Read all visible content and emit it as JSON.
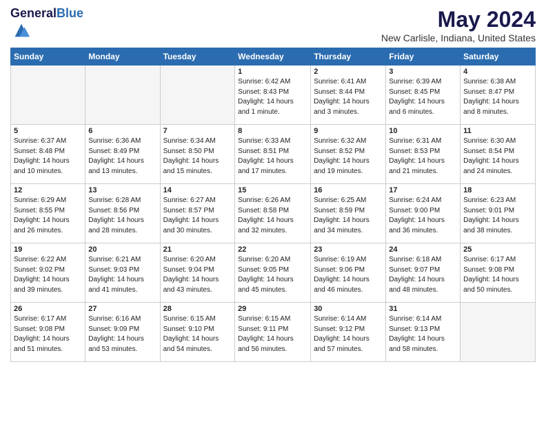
{
  "header": {
    "logo_general": "General",
    "logo_blue": "Blue",
    "month_year": "May 2024",
    "location": "New Carlisle, Indiana, United States"
  },
  "weekdays": [
    "Sunday",
    "Monday",
    "Tuesday",
    "Wednesday",
    "Thursday",
    "Friday",
    "Saturday"
  ],
  "weeks": [
    [
      {
        "day": "",
        "info": ""
      },
      {
        "day": "",
        "info": ""
      },
      {
        "day": "",
        "info": ""
      },
      {
        "day": "1",
        "info": "Sunrise: 6:42 AM\nSunset: 8:43 PM\nDaylight: 14 hours\nand 1 minute."
      },
      {
        "day": "2",
        "info": "Sunrise: 6:41 AM\nSunset: 8:44 PM\nDaylight: 14 hours\nand 3 minutes."
      },
      {
        "day": "3",
        "info": "Sunrise: 6:39 AM\nSunset: 8:45 PM\nDaylight: 14 hours\nand 6 minutes."
      },
      {
        "day": "4",
        "info": "Sunrise: 6:38 AM\nSunset: 8:47 PM\nDaylight: 14 hours\nand 8 minutes."
      }
    ],
    [
      {
        "day": "5",
        "info": "Sunrise: 6:37 AM\nSunset: 8:48 PM\nDaylight: 14 hours\nand 10 minutes."
      },
      {
        "day": "6",
        "info": "Sunrise: 6:36 AM\nSunset: 8:49 PM\nDaylight: 14 hours\nand 13 minutes."
      },
      {
        "day": "7",
        "info": "Sunrise: 6:34 AM\nSunset: 8:50 PM\nDaylight: 14 hours\nand 15 minutes."
      },
      {
        "day": "8",
        "info": "Sunrise: 6:33 AM\nSunset: 8:51 PM\nDaylight: 14 hours\nand 17 minutes."
      },
      {
        "day": "9",
        "info": "Sunrise: 6:32 AM\nSunset: 8:52 PM\nDaylight: 14 hours\nand 19 minutes."
      },
      {
        "day": "10",
        "info": "Sunrise: 6:31 AM\nSunset: 8:53 PM\nDaylight: 14 hours\nand 21 minutes."
      },
      {
        "day": "11",
        "info": "Sunrise: 6:30 AM\nSunset: 8:54 PM\nDaylight: 14 hours\nand 24 minutes."
      }
    ],
    [
      {
        "day": "12",
        "info": "Sunrise: 6:29 AM\nSunset: 8:55 PM\nDaylight: 14 hours\nand 26 minutes."
      },
      {
        "day": "13",
        "info": "Sunrise: 6:28 AM\nSunset: 8:56 PM\nDaylight: 14 hours\nand 28 minutes."
      },
      {
        "day": "14",
        "info": "Sunrise: 6:27 AM\nSunset: 8:57 PM\nDaylight: 14 hours\nand 30 minutes."
      },
      {
        "day": "15",
        "info": "Sunrise: 6:26 AM\nSunset: 8:58 PM\nDaylight: 14 hours\nand 32 minutes."
      },
      {
        "day": "16",
        "info": "Sunrise: 6:25 AM\nSunset: 8:59 PM\nDaylight: 14 hours\nand 34 minutes."
      },
      {
        "day": "17",
        "info": "Sunrise: 6:24 AM\nSunset: 9:00 PM\nDaylight: 14 hours\nand 36 minutes."
      },
      {
        "day": "18",
        "info": "Sunrise: 6:23 AM\nSunset: 9:01 PM\nDaylight: 14 hours\nand 38 minutes."
      }
    ],
    [
      {
        "day": "19",
        "info": "Sunrise: 6:22 AM\nSunset: 9:02 PM\nDaylight: 14 hours\nand 39 minutes."
      },
      {
        "day": "20",
        "info": "Sunrise: 6:21 AM\nSunset: 9:03 PM\nDaylight: 14 hours\nand 41 minutes."
      },
      {
        "day": "21",
        "info": "Sunrise: 6:20 AM\nSunset: 9:04 PM\nDaylight: 14 hours\nand 43 minutes."
      },
      {
        "day": "22",
        "info": "Sunrise: 6:20 AM\nSunset: 9:05 PM\nDaylight: 14 hours\nand 45 minutes."
      },
      {
        "day": "23",
        "info": "Sunrise: 6:19 AM\nSunset: 9:06 PM\nDaylight: 14 hours\nand 46 minutes."
      },
      {
        "day": "24",
        "info": "Sunrise: 6:18 AM\nSunset: 9:07 PM\nDaylight: 14 hours\nand 48 minutes."
      },
      {
        "day": "25",
        "info": "Sunrise: 6:17 AM\nSunset: 9:08 PM\nDaylight: 14 hours\nand 50 minutes."
      }
    ],
    [
      {
        "day": "26",
        "info": "Sunrise: 6:17 AM\nSunset: 9:08 PM\nDaylight: 14 hours\nand 51 minutes."
      },
      {
        "day": "27",
        "info": "Sunrise: 6:16 AM\nSunset: 9:09 PM\nDaylight: 14 hours\nand 53 minutes."
      },
      {
        "day": "28",
        "info": "Sunrise: 6:15 AM\nSunset: 9:10 PM\nDaylight: 14 hours\nand 54 minutes."
      },
      {
        "day": "29",
        "info": "Sunrise: 6:15 AM\nSunset: 9:11 PM\nDaylight: 14 hours\nand 56 minutes."
      },
      {
        "day": "30",
        "info": "Sunrise: 6:14 AM\nSunset: 9:12 PM\nDaylight: 14 hours\nand 57 minutes."
      },
      {
        "day": "31",
        "info": "Sunrise: 6:14 AM\nSunset: 9:13 PM\nDaylight: 14 hours\nand 58 minutes."
      },
      {
        "day": "",
        "info": ""
      }
    ]
  ]
}
